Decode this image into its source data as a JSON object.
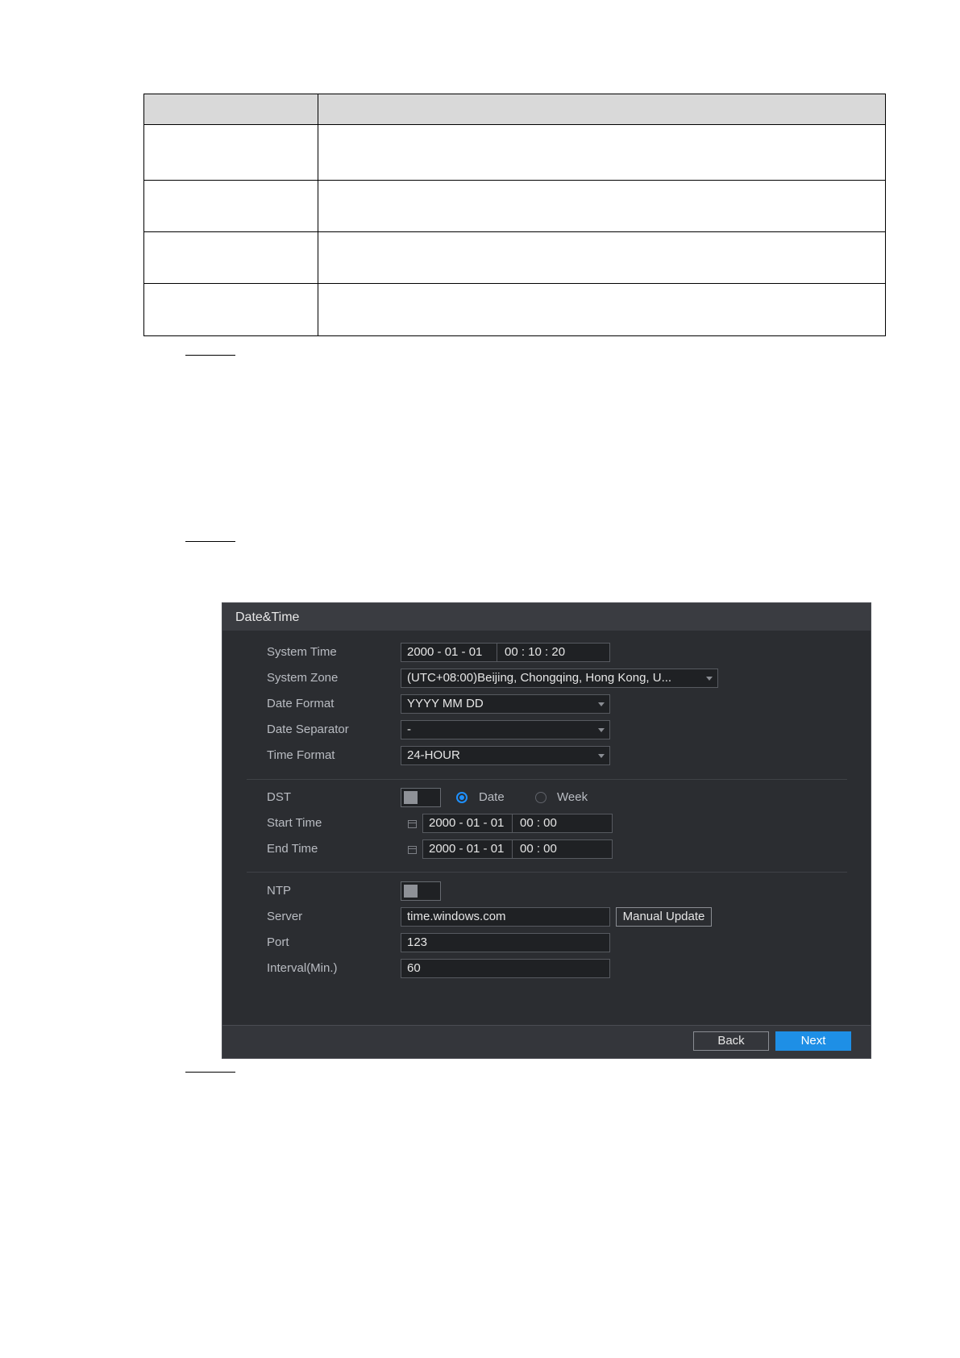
{
  "dialog": {
    "title": "Date&Time",
    "labels": {
      "system_time": "System Time",
      "system_zone": "System Zone",
      "date_format": "Date Format",
      "date_separator": "Date Separator",
      "time_format": "Time Format",
      "dst": "DST",
      "start_time": "Start Time",
      "end_time": "End Time",
      "ntp": "NTP",
      "server": "Server",
      "port": "Port",
      "interval": "Interval(Min.)"
    },
    "values": {
      "system_date": "2000  - 01 - 01",
      "system_clock": "00 : 10 : 20",
      "system_zone": "(UTC+08:00)Beijing, Chongqing, Hong Kong, U...",
      "date_format": "YYYY MM DD",
      "date_separator": "-",
      "time_format": "24-HOUR",
      "start_date": "2000 - 01 - 01",
      "start_clock": "00 : 00",
      "end_date": "2000 - 01 - 01",
      "end_clock": "00 : 00",
      "server": "time.windows.com",
      "port": "123",
      "interval": "60"
    },
    "dst_options": {
      "date": "Date",
      "week": "Week",
      "selected": "date"
    },
    "toggles": {
      "dst_enabled": false,
      "ntp_enabled": false
    },
    "buttons": {
      "manual_update": "Manual Update",
      "back": "Back",
      "next": "Next"
    },
    "colors": {
      "accent": "#1e8fe6",
      "background": "#2b2d31",
      "header": "#3a3c41"
    }
  }
}
